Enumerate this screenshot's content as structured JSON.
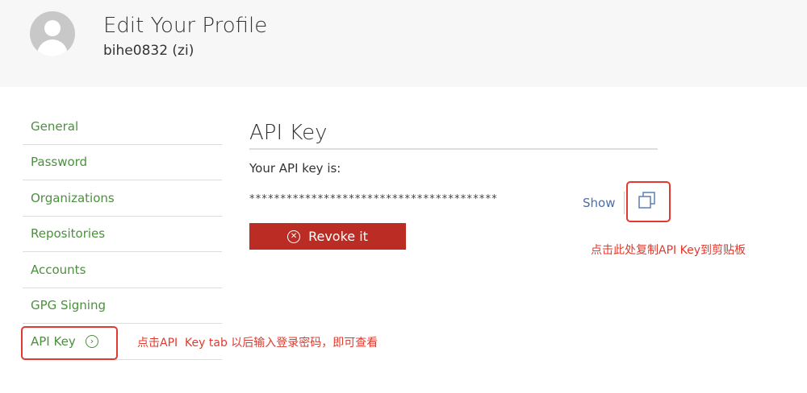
{
  "header": {
    "title": "Edit Your Profile",
    "username": "bihe0832 (zi)"
  },
  "sidebar": {
    "items": [
      {
        "label": "General"
      },
      {
        "label": "Password"
      },
      {
        "label": "Organizations"
      },
      {
        "label": "Repositories"
      },
      {
        "label": "Accounts"
      },
      {
        "label": "GPG Signing"
      },
      {
        "label": "API Key",
        "active": true
      }
    ]
  },
  "main": {
    "heading": "API Key",
    "key_label": "Your API key is:",
    "masked_key": "****************************************",
    "show_label": "Show",
    "revoke_label": "Revoke it"
  },
  "annotations": {
    "copy_note": "点击此处复制API Key到剪贴板",
    "tab_note": "点击API  Key tab 以后输入登录密码，即可查看"
  },
  "colors": {
    "accent_green": "#4c8f3f",
    "danger": "#bb2d24",
    "link": "#4a6ea8",
    "annotation": "#e03a2e"
  }
}
